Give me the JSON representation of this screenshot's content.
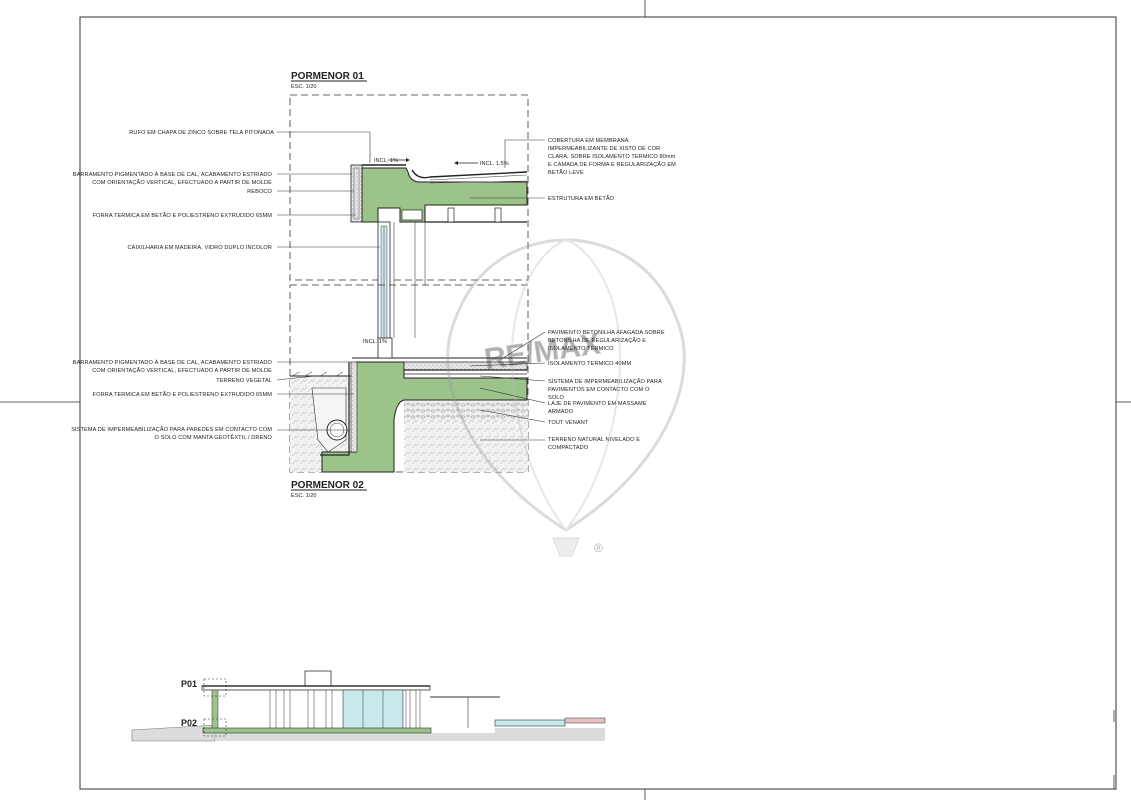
{
  "details": {
    "p01": {
      "title": "PORMENOR 01",
      "scale": "ESC. 1/20"
    },
    "p02": {
      "title": "PORMENOR 02",
      "scale": "ESC. 1/20"
    }
  },
  "slopes": {
    "incl_1a": "INCL. 1%",
    "incl_15": "INCL. 1.5%",
    "incl_1b": "INCL. 1%"
  },
  "labels_left": {
    "rufo": "RUFO EM CHAPA DE ZINCO SOBRE TELA PITONADA",
    "barramento1_l1": "BARRAMENTO PIGMENTADO À BASE DE CAL, ACABAMENTO ESTRIADO",
    "barramento1_l2": "COM ORIENTAÇÃO VERTICAL, EFECTUADO A PARTIR DE MOLDE",
    "reboco": "REBOCO",
    "forra1": "FORRA TERMICA EM BETÃO E POLIESTRENO EXTRUDIDO 65MM",
    "caixilharia": "CAIXILHARIA EM MADEIRA, VIDRO DUPLO INCOLOR",
    "barramento2_l1": "BARRAMENTO PIGMENTADO À BASE DE CAL, ACABAMENTO ESTRIADO",
    "barramento2_l2": "COM ORIENTAÇÃO VERTICAL, EFECTUADO A PARTIR DE MOLDE",
    "terreno_vegetal": "TERRENO VEGETAL",
    "forra2": "FORRA TERMICA EM BETÃO E POLIESTRENO EXTRUDIDO 65MM",
    "sistema_paredes_l1": "SISTEMA DE IMPERMEABILIZAÇÃO PARA PAREDES EM CONTACTO COM",
    "sistema_paredes_l2": "O SOLO COM MANTA GEOTÊXTIL / DRENO"
  },
  "labels_right": {
    "cobertura_l1": "COBERTURA EM MEMBRANA",
    "cobertura_l2": "IMPERMEABILIZANTE DE XISTO DE COR",
    "cobertura_l3": "CLARA, SOBRE ISOLAMENTO TERMICO 80mm",
    "cobertura_l4": "E CAMADA DE FORMA E REGULARIZAÇÃO EM",
    "cobertura_l5": "BETÃO LEVE",
    "estrutura": "ESTRUTURA EM BETÃO",
    "pavimento_l1": "PAVIMENTO BETONILHA AFAGADA SOBRE",
    "pavimento_l2": "BETONILHA DE REGULARIZAÇÃO E",
    "pavimento_l3": "ISOLAMENTO TERMICO",
    "isolamento": "ISOLAMENTO TERMICO 40MM",
    "sistema_pav_l1": "SISTEMA DE IMPERMEABILIZAÇÃO PARA",
    "sistema_pav_l2": "PAVIMENTOS EM CONTACTO COM O",
    "sistema_pav_l3": "SOLO",
    "laje_l1": "LAJE DE PAVIMENTO EM MASSAME",
    "laje_l2": "ARMADO",
    "tout": "TOUT VENANT",
    "terreno_nat_l1": "TERRENO NATURAL NIVELADO E",
    "terreno_nat_l2": "COMPACTADO"
  },
  "section_keys": {
    "p01": "P01",
    "p02": "P02"
  },
  "watermark": {
    "brand": "RE/MAX",
    "mark": "®"
  },
  "colors": {
    "concrete": "#9cc38a",
    "line": "#222222",
    "glass": "#c8e8ec"
  }
}
